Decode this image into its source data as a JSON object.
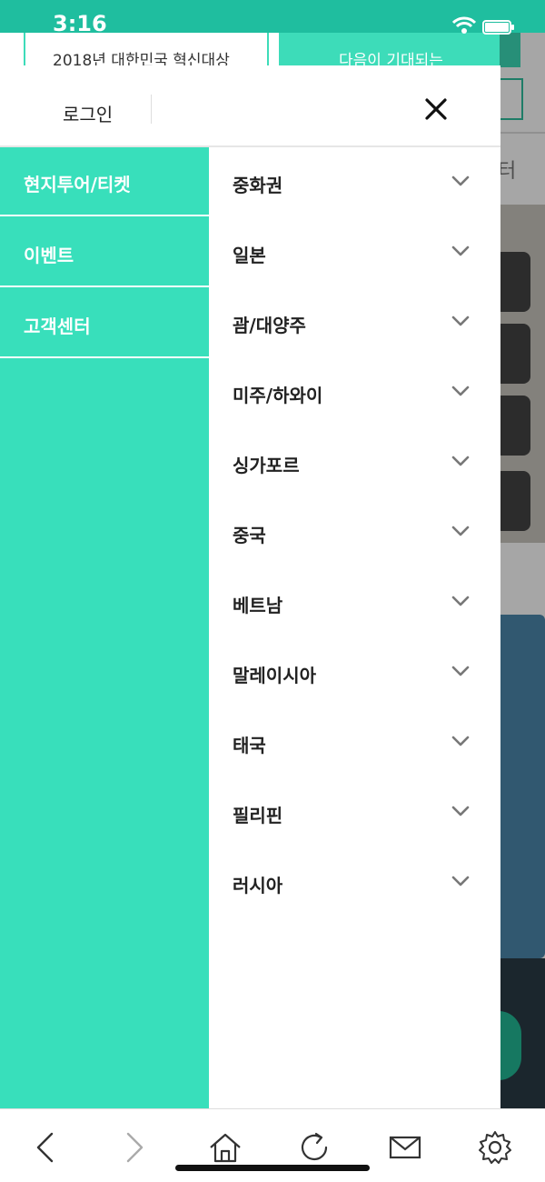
{
  "status_bar": {
    "time": "3:16"
  },
  "background": {
    "card1_text": "2018년 대한민국 혁신대상",
    "card2_text": "다음이 기대되는",
    "login_box_text": "I",
    "menu_fragment": "터"
  },
  "drawer": {
    "login_label": "로그인",
    "categories": [
      {
        "label": "현지투어/티켓"
      },
      {
        "label": "이벤트"
      },
      {
        "label": "고객센터"
      }
    ],
    "regions": [
      {
        "label": "중화권"
      },
      {
        "label": "일본"
      },
      {
        "label": "괌/대양주"
      },
      {
        "label": "미주/하와이"
      },
      {
        "label": "싱가포르"
      },
      {
        "label": "중국"
      },
      {
        "label": "베트남"
      },
      {
        "label": "말레이시아"
      },
      {
        "label": "태국"
      },
      {
        "label": "필리핀"
      },
      {
        "label": "러시아"
      }
    ]
  },
  "toolbar": {
    "icons": [
      "back-icon",
      "forward-icon",
      "home-icon",
      "refresh-icon",
      "mail-icon",
      "settings-icon"
    ]
  },
  "colors": {
    "accent": "#38dfbb",
    "status_bar": "#1fbe9f"
  }
}
